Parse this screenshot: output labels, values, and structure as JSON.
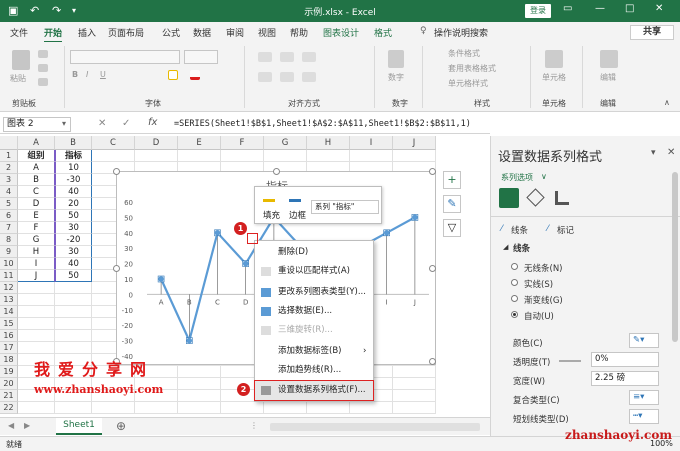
{
  "window": {
    "title": "示例.xlsx - Excel",
    "login_label": "登录",
    "quick_access": [
      "↶",
      "↷"
    ]
  },
  "ribbon_tabs": [
    "文件",
    "开始",
    "插入",
    "页面布局",
    "公式",
    "数据",
    "审阅",
    "视图",
    "帮助",
    "图表设计",
    "格式",
    "操作说明搜索"
  ],
  "share_label": "共享",
  "ribbon": {
    "groups": [
      "剪贴板",
      "字体",
      "对齐方式",
      "数字",
      "样式",
      "单元格",
      "编辑"
    ],
    "paste_label": "粘贴",
    "number_label": "数字",
    "style_items": [
      "条件格式",
      "套用表格格式",
      "单元格样式"
    ],
    "cells_label": "单元格",
    "edit_label": "编辑"
  },
  "formula_bar": {
    "name_box": "图表 2",
    "fx": "fx",
    "formula": "=SERIES(Sheet1!$B$1,Sheet1!$A$2:$A$11,Sheet1!$B$2:$B$11,1)"
  },
  "sheet": {
    "columns": [
      "A",
      "B",
      "C",
      "D",
      "E",
      "F",
      "G",
      "H",
      "I",
      "J"
    ],
    "rows": [
      "1",
      "2",
      "3",
      "4",
      "5",
      "6",
      "7",
      "8",
      "9",
      "10",
      "11",
      "12",
      "13",
      "14",
      "15",
      "16",
      "17",
      "18",
      "19",
      "20",
      "21",
      "22"
    ],
    "header": [
      "组别",
      "指标"
    ],
    "data": [
      [
        "A",
        "10"
      ],
      [
        "B",
        "-30"
      ],
      [
        "C",
        "40"
      ],
      [
        "D",
        "20"
      ],
      [
        "E",
        "50"
      ],
      [
        "F",
        "30"
      ],
      [
        "G",
        "-20"
      ],
      [
        "H",
        "30"
      ],
      [
        "I",
        "40"
      ],
      [
        "J",
        "50"
      ]
    ]
  },
  "chart_data": {
    "type": "line",
    "title": "指标",
    "categories": [
      "A",
      "B",
      "C",
      "D",
      "E",
      "F",
      "G",
      "H",
      "I",
      "J"
    ],
    "series": [
      {
        "name": "指标",
        "values": [
          10,
          -30,
          40,
          20,
          50,
          30,
          -20,
          30,
          40,
          50
        ]
      }
    ],
    "ylim": [
      -40,
      60
    ],
    "yticks": [
      "60",
      "50",
      "40",
      "30",
      "20",
      "10",
      "0",
      "-10",
      "-20",
      "-30",
      "-40"
    ],
    "color": "#5b9bd5"
  },
  "mini_toolbar": {
    "fill_label": "填充",
    "border_label": "边框",
    "series_select": "系列 \"指标\""
  },
  "context_menu": {
    "items": [
      "删除(D)",
      "重设以匹配样式(A)",
      "更改系列图表类型(Y)...",
      "选择数据(E)...",
      "三维旋转(R)...",
      "添加数据标签(B)",
      "添加趋势线(R)...",
      "设置数据系列格式(F)..."
    ]
  },
  "badges": [
    "1",
    "2"
  ],
  "task_pane": {
    "title": "设置数据系列格式",
    "options_label": "系列选项",
    "tabs": [
      "线条",
      "标记"
    ],
    "section": "线条",
    "options": [
      "无线条(N)",
      "实线(S)",
      "渐变线(G)",
      "自动(U)"
    ],
    "selected_option": "自动(U)",
    "color_label": "颜色(C)",
    "transparency_label": "透明度(T)",
    "transparency_value": "0%",
    "width_label": "宽度(W)",
    "width_value": "2.25 磅",
    "compound_label": "复合类型(C)",
    "dash_label": "短划线类型(D)"
  },
  "sheet_tab": "Sheet1",
  "status": {
    "ready": "就绪",
    "zoom": "100%"
  },
  "watermark": {
    "line1": "我爱分享网",
    "line2": "www.zhanshaoyi.com",
    "corner": "zhanshaoyi.com"
  }
}
